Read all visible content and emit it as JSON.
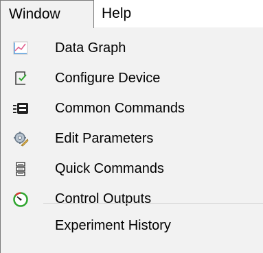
{
  "menubar": {
    "items": [
      {
        "label": "Window"
      },
      {
        "label": "Help"
      }
    ]
  },
  "menu": {
    "items": [
      {
        "label": "Data Graph",
        "icon": "line-graph-icon"
      },
      {
        "label": "Configure Device",
        "icon": "configure-device-icon"
      },
      {
        "label": "Common Commands",
        "icon": "common-commands-icon"
      },
      {
        "label": "Edit Parameters",
        "icon": "edit-parameters-icon"
      },
      {
        "label": "Quick Commands",
        "icon": "quick-commands-icon"
      },
      {
        "label": "Control Outputs",
        "icon": "gauge-icon"
      }
    ],
    "footer_items": [
      {
        "label": "Experiment History"
      }
    ]
  },
  "colors": {
    "menu_bg": "#f2f2f2",
    "menubar_bg": "#ffffff",
    "border": "#7a7a7a",
    "separator": "#d7d7d7",
    "accent_green": "#2ea52e",
    "accent_red": "#d33"
  }
}
